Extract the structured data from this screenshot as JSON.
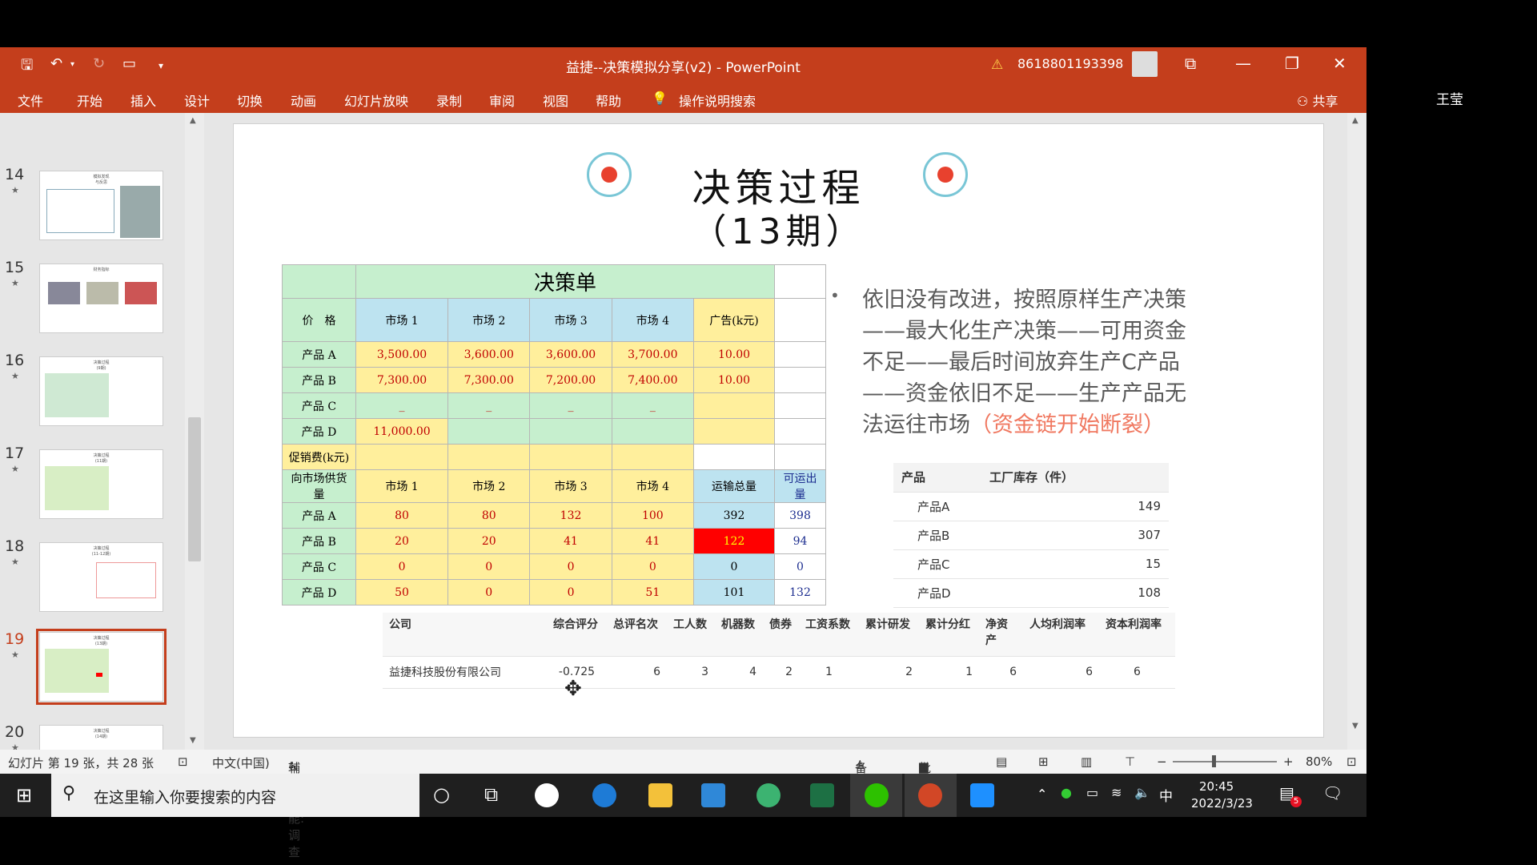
{
  "window": {
    "title": "益捷--决策模拟分享(v2)  -  PowerPoint",
    "account": "8618801193398",
    "warning_icon": "warning-icon"
  },
  "ribbon": {
    "tabs": [
      "文件",
      "开始",
      "插入",
      "设计",
      "切换",
      "动画",
      "幻灯片放映",
      "录制",
      "审阅",
      "视图",
      "帮助"
    ],
    "search": "操作说明搜索",
    "share": "共享"
  },
  "participant": "王莹",
  "thumbnails": [
    {
      "num": "14",
      "title": "模拟发现\n与反思"
    },
    {
      "num": "15",
      "title": "财务指标"
    },
    {
      "num": "16",
      "title": "决策过程\n(9期)"
    },
    {
      "num": "17",
      "title": "决策过程\n(11期)"
    },
    {
      "num": "18",
      "title": "决策过程\n(11-12期)"
    },
    {
      "num": "19",
      "title": "决策过程\n(13期)"
    },
    {
      "num": "20",
      "title": "决策过程\n(14期)"
    }
  ],
  "slide": {
    "title_line1": "决策过程",
    "title_line2": "（13期）",
    "decision_table": {
      "title": "决策单",
      "price_header": [
        "价　格",
        "市场 1",
        "市场 2",
        "市场 3",
        "市场 4",
        "广告(k元)"
      ],
      "price_rows": [
        [
          "产品 A",
          "3,500.00",
          "3,600.00",
          "3,600.00",
          "3,700.00",
          "10.00"
        ],
        [
          "产品 B",
          "7,300.00",
          "7,300.00",
          "7,200.00",
          "7,400.00",
          "10.00"
        ],
        [
          "产品 C",
          "_",
          "_",
          "_",
          "_",
          ""
        ],
        [
          "产品 D",
          "11,000.00",
          "",
          "",
          "",
          ""
        ]
      ],
      "promo_label": "促销费(k元)",
      "supply_header": [
        "向市场供货量",
        "市场 1",
        "市场 2",
        "市场 3",
        "市场 4",
        "运输总量",
        "可运出量"
      ],
      "supply_rows": [
        [
          "产品 A",
          "80",
          "80",
          "132",
          "100",
          "392",
          "398"
        ],
        [
          "产品 B",
          "20",
          "20",
          "41",
          "41",
          "122",
          "94"
        ],
        [
          "产品 C",
          "0",
          "0",
          "0",
          "0",
          "0",
          "0"
        ],
        [
          "产品 D",
          "50",
          "0",
          "0",
          "51",
          "101",
          "132"
        ]
      ]
    },
    "bullet_main": "依旧没有改进，按照原样生产决策——最大化生产决策——可用资金不足——最后时间放弃生产C产品——资金依旧不足——生产产品无法运往市场",
    "bullet_highlight": "（资金链开始断裂）",
    "inventory": {
      "headers": [
        "产品",
        "工厂库存（件）"
      ],
      "rows": [
        [
          "产品A",
          "149"
        ],
        [
          "产品B",
          "307"
        ],
        [
          "产品C",
          "15"
        ],
        [
          "产品D",
          "108"
        ]
      ]
    },
    "company": {
      "headers": [
        "公司",
        "综合评分",
        "总评名次",
        "工人数",
        "机器数",
        "债券",
        "工资系数",
        "累计研发",
        "累计分红",
        "净资产",
        "人均利润率",
        "资本利润率"
      ],
      "row": [
        "益捷科技股份有限公司",
        "-0.725",
        "6",
        "3",
        "4",
        "2",
        "1",
        "2",
        "1",
        "6",
        "6",
        "6"
      ]
    }
  },
  "status": {
    "slide_info": "幻灯片 第 19 张，共 28 张",
    "language": "中文(中国)",
    "accessibility": "辅助功能: 调查",
    "notes": "备注",
    "comments": "批注",
    "zoom": "80%"
  },
  "taskbar": {
    "search_placeholder": "在这里输入你要搜索的内容",
    "time": "20:45",
    "date": "2022/3/23",
    "lang": "中",
    "badge": "5"
  }
}
